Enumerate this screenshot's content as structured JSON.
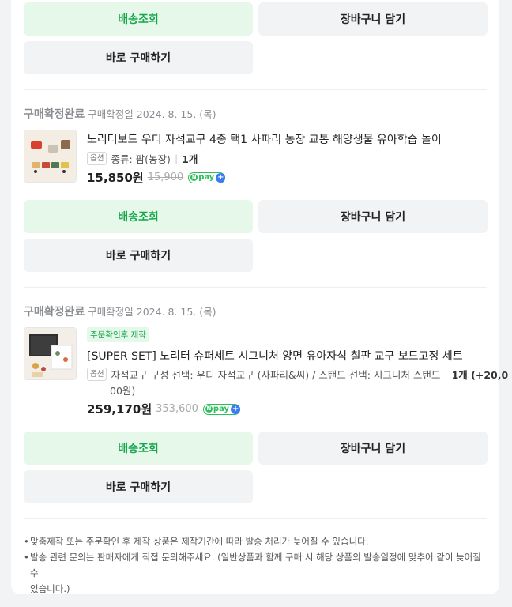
{
  "buttons": {
    "track": "배송조회",
    "cart": "장바구니 담기",
    "buy_now": "바로 구매하기"
  },
  "orders": [
    {
      "status": "구매확정완료",
      "date": "구매확정일 2024. 8. 15. (목)",
      "title": "노리터보드 우디 자석교구 4종 택1 사파리 농장 교통 해양생물 유아학습 놀이",
      "option_badge": "옵션",
      "option": "종류: 팜(농장)",
      "qty": "1개",
      "price": "15,850원",
      "orig_price": "15,900",
      "npay": "pay"
    },
    {
      "status": "구매확정완료",
      "date": "구매확정일 2024. 8. 15. (목)",
      "made_badge": "주문확인후 제작",
      "title": "[SUPER SET] 노리터 슈퍼세트 시그니처 양면 유아자석 칠판 교구 보드고정 세트",
      "option_badge": "옵션",
      "option": "자석교구 구성 선택: 우디 자석교구 (사파리&씨) / 스탠드 선택: 시그니처 스탠드",
      "qty": "1개 (+20,0",
      "qty_cont": "00원)",
      "price": "259,170원",
      "orig_price": "353,600",
      "npay": "pay"
    }
  ],
  "notices": [
    "맞춤제작 또는 주문확인 후 제작 상품은 제작기간에 따라 발송 처리가 늦어질 수 있습니다.",
    "발송 관련 문의는 판매자에게 직접 문의해주세요. (일반상품과 함께 구매 시 해당 상품의 발송일정에 맞추어 같이 늦어질 수",
    "있습니다.)"
  ],
  "colors": {
    "accent_green": "#16a74a",
    "green_bg": "#e6f8ea",
    "gray_bg": "#f2f3f5"
  }
}
